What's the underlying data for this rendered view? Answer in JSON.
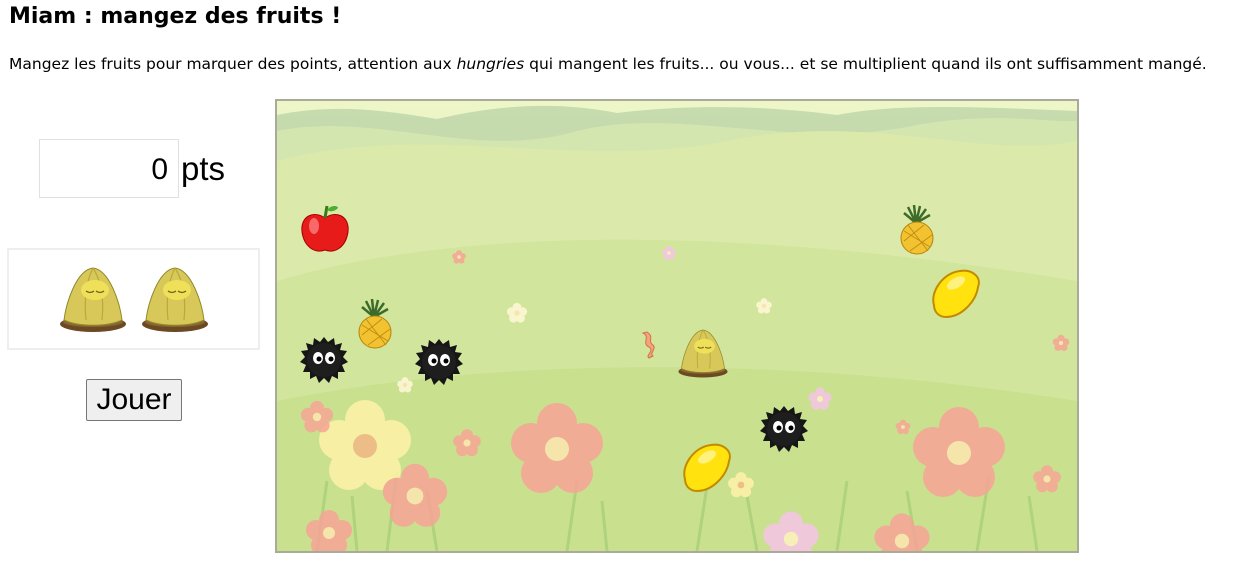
{
  "page": {
    "title": "Miam : mangez des fruits !",
    "intro_before": "Mangez les fruits pour marquer des points, attention aux ",
    "intro_em": "hungries",
    "intro_after": " qui mangent les fruits... ou vous... et se multiplient quand ils ont suffisamment mangé."
  },
  "score": {
    "value": "0",
    "unit": "pts"
  },
  "lives": {
    "count": 2,
    "icon": "yellow-blob-creature-icon"
  },
  "controls": {
    "play_label": "Jouer"
  },
  "game": {
    "sprites": [
      "apple-icon",
      "pineapple-icon",
      "pineapple-icon",
      "lemon-icon",
      "lemon-icon",
      "hungry-creature-icon",
      "hungry-creature-icon",
      "hungry-creature-icon",
      "player-creature-icon",
      "bacon-icon"
    ],
    "colors": {
      "meadow": "#d3e7a0",
      "hills": "#b7cfa1",
      "flower_pink": "#f7a6a0",
      "flower_yellow": "#fff4b0"
    }
  }
}
